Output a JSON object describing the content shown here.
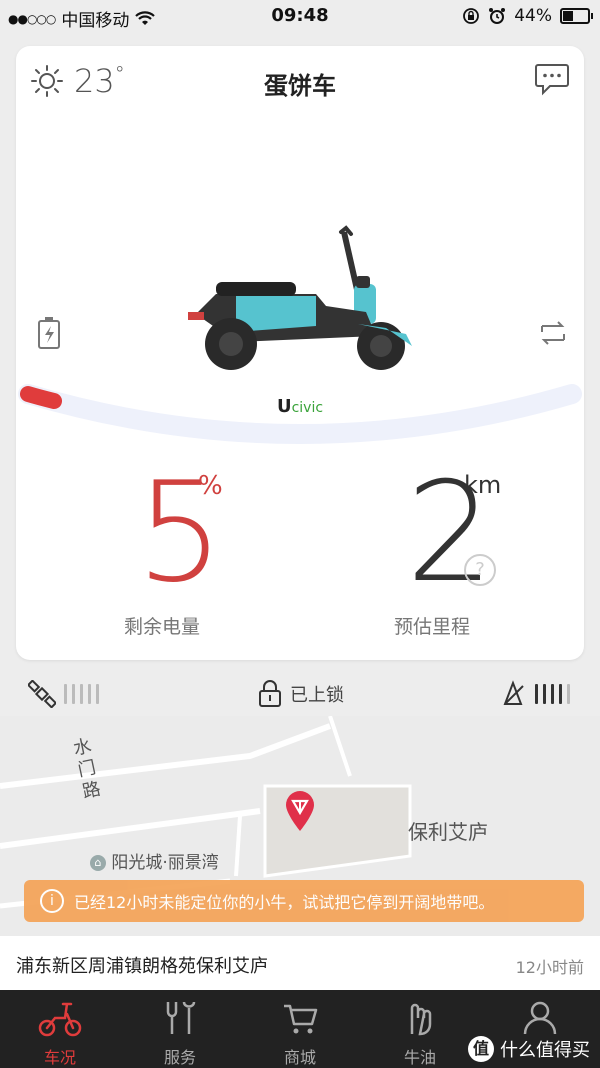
{
  "status_bar": {
    "carrier": "中国移动",
    "time": "09:48",
    "battery_percent_label": "44%",
    "battery_fill": 0.44
  },
  "card": {
    "title": "蛋饼车",
    "temperature": "23",
    "temperature_unit": "°",
    "brand_u": "U",
    "brand": "civic",
    "battery_value": "5",
    "battery_unit": "%",
    "battery_label": "剩余电量",
    "range_value": "2",
    "range_unit": "km",
    "range_label": "预估里程",
    "help_glyph": "?",
    "battery_level": 0.05,
    "colors": {
      "battery": "#d0413f",
      "accent": "#e03c3c"
    }
  },
  "status_row": {
    "gps_bars_on": 0,
    "lock_label": "已上锁",
    "signal_bars_on": 4
  },
  "map": {
    "road_label": "水门路",
    "place_1": "保利艾庐",
    "place_2": "阳光城·丽景湾"
  },
  "notice": {
    "icon": "i",
    "text": "已经12小时未能定位你的小牛，试试把它停到开阔地带吧。"
  },
  "address": {
    "text": "浦东新区周浦镇朗格苑保利艾庐",
    "time_ago": "12小时前"
  },
  "tabs": [
    {
      "label": "车况",
      "icon": "scooter-icon",
      "active": true
    },
    {
      "label": "服务",
      "icon": "wrench-icon",
      "active": false
    },
    {
      "label": "商城",
      "icon": "cart-icon",
      "active": false
    },
    {
      "label": "牛油",
      "icon": "hand-icon",
      "active": false
    },
    {
      "label": "我",
      "icon": "user-icon",
      "active": false
    }
  ],
  "watermark": {
    "text": "什么值得买",
    "mark": "值"
  }
}
